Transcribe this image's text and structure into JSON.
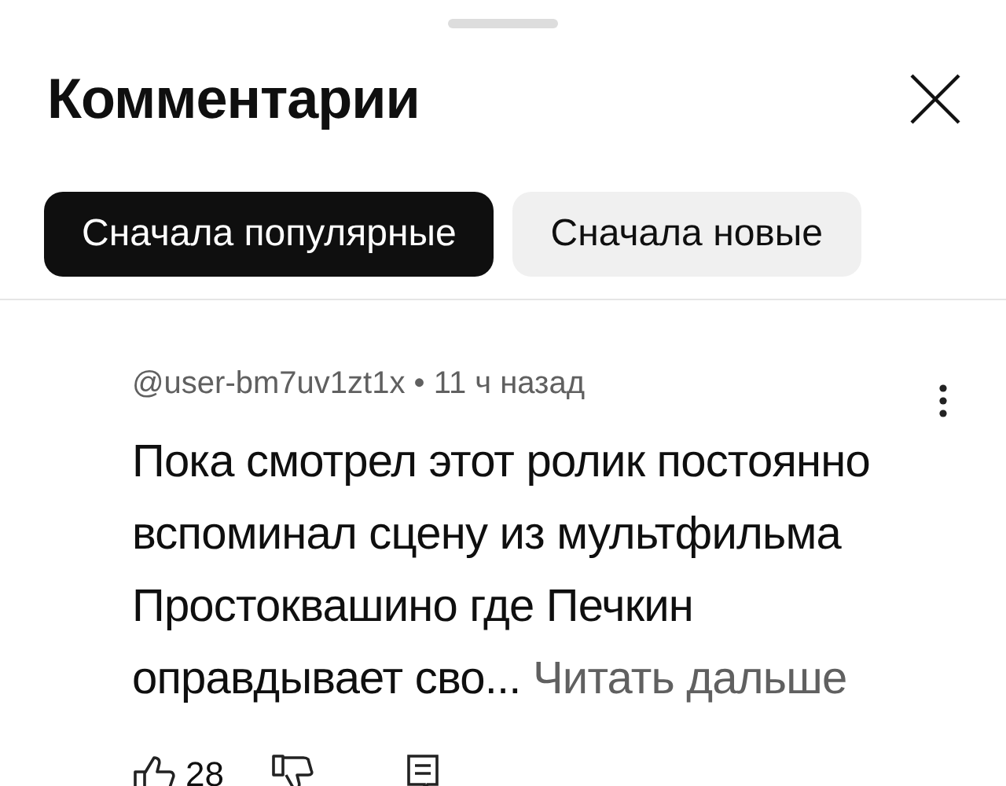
{
  "sheet": {
    "title": "Комментарии"
  },
  "sort_tabs": [
    {
      "label": "Сначала популярные",
      "selected": true
    },
    {
      "label": "Сначала новые",
      "selected": false
    }
  ],
  "comment": {
    "author": "@user-bm7uv1zt1x",
    "separator": "•",
    "time": "11 ч назад",
    "text": "Пока смотрел этот ролик постоянно вспоминал сцену из мультфильма Простоквашино где Печкин оправдывает сво...",
    "read_more": "Читать дальше",
    "likes": "28"
  }
}
